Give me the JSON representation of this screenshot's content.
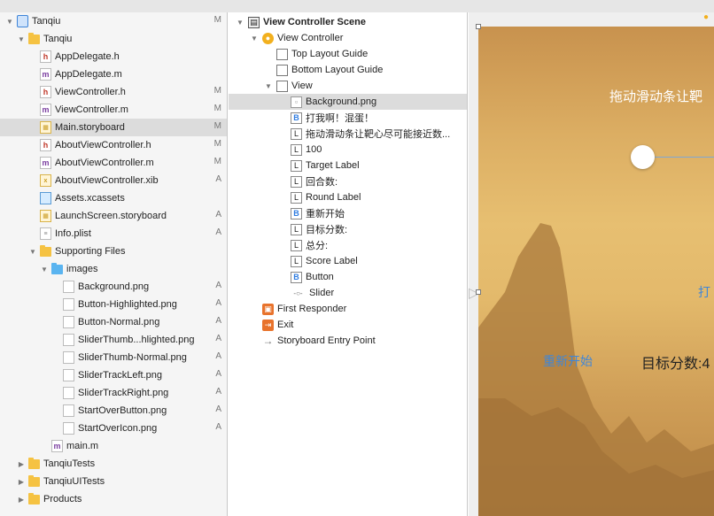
{
  "navigator": {
    "items": [
      {
        "label": "Tanqiu",
        "badge": "M",
        "icon": "xcode-project-icon",
        "kind": "proj",
        "indent": 0,
        "disclosure": "open"
      },
      {
        "label": "Tanqiu",
        "badge": "",
        "icon": "folder-icon",
        "kind": "folder",
        "indent": 1,
        "disclosure": "open"
      },
      {
        "label": "AppDelegate.h",
        "badge": "",
        "icon": "header-file-icon",
        "kind": "h",
        "indent": 2,
        "disclosure": ""
      },
      {
        "label": "AppDelegate.m",
        "badge": "",
        "icon": "implementation-file-icon",
        "kind": "m",
        "indent": 2,
        "disclosure": ""
      },
      {
        "label": "ViewController.h",
        "badge": "M",
        "icon": "header-file-icon",
        "kind": "h",
        "indent": 2,
        "disclosure": ""
      },
      {
        "label": "ViewController.m",
        "badge": "M",
        "icon": "implementation-file-icon",
        "kind": "m",
        "indent": 2,
        "disclosure": ""
      },
      {
        "label": "Main.storyboard",
        "badge": "M",
        "icon": "storyboard-file-icon",
        "kind": "sb",
        "indent": 2,
        "disclosure": "",
        "selected": true
      },
      {
        "label": "AboutViewController.h",
        "badge": "M",
        "icon": "header-file-icon",
        "kind": "h",
        "indent": 2,
        "disclosure": ""
      },
      {
        "label": "AboutViewController.m",
        "badge": "M",
        "icon": "implementation-file-icon",
        "kind": "m",
        "indent": 2,
        "disclosure": ""
      },
      {
        "label": "AboutViewController.xib",
        "badge": "A",
        "icon": "xib-file-icon",
        "kind": "xib",
        "indent": 2,
        "disclosure": ""
      },
      {
        "label": "Assets.xcassets",
        "badge": "",
        "icon": "asset-catalog-icon",
        "kind": "assets",
        "indent": 2,
        "disclosure": ""
      },
      {
        "label": "LaunchScreen.storyboard",
        "badge": "A",
        "icon": "storyboard-file-icon",
        "kind": "sb",
        "indent": 2,
        "disclosure": ""
      },
      {
        "label": "Info.plist",
        "badge": "A",
        "icon": "plist-file-icon",
        "kind": "plist",
        "indent": 2,
        "disclosure": ""
      },
      {
        "label": "Supporting Files",
        "badge": "",
        "icon": "folder-icon",
        "kind": "folder",
        "indent": 2,
        "disclosure": "open"
      },
      {
        "label": "images",
        "badge": "",
        "icon": "blue-folder-icon",
        "kind": "bluefolder",
        "indent": 3,
        "disclosure": "open"
      },
      {
        "label": "Background.png",
        "badge": "A",
        "icon": "image-file-icon",
        "kind": "img",
        "indent": 4,
        "disclosure": ""
      },
      {
        "label": "Button-Highlighted.png",
        "badge": "A",
        "icon": "image-file-icon",
        "kind": "img",
        "indent": 4,
        "disclosure": ""
      },
      {
        "label": "Button-Normal.png",
        "badge": "A",
        "icon": "image-file-icon",
        "kind": "img",
        "indent": 4,
        "disclosure": ""
      },
      {
        "label": "SliderThumb...hlighted.png",
        "badge": "A",
        "icon": "image-file-icon",
        "kind": "img",
        "indent": 4,
        "disclosure": ""
      },
      {
        "label": "SliderThumb-Normal.png",
        "badge": "A",
        "icon": "image-file-icon",
        "kind": "img",
        "indent": 4,
        "disclosure": ""
      },
      {
        "label": "SliderTrackLeft.png",
        "badge": "A",
        "icon": "image-file-icon",
        "kind": "img",
        "indent": 4,
        "disclosure": ""
      },
      {
        "label": "SliderTrackRight.png",
        "badge": "A",
        "icon": "image-file-icon",
        "kind": "img",
        "indent": 4,
        "disclosure": ""
      },
      {
        "label": "StartOverButton.png",
        "badge": "A",
        "icon": "image-file-icon",
        "kind": "img",
        "indent": 4,
        "disclosure": ""
      },
      {
        "label": "StartOverIcon.png",
        "badge": "A",
        "icon": "image-file-icon",
        "kind": "img",
        "indent": 4,
        "disclosure": ""
      },
      {
        "label": "main.m",
        "badge": "",
        "icon": "implementation-file-icon",
        "kind": "m",
        "indent": 3,
        "disclosure": ""
      },
      {
        "label": "TanqiuTests",
        "badge": "",
        "icon": "folder-icon",
        "kind": "folder",
        "indent": 1,
        "disclosure": "closed"
      },
      {
        "label": "TanqiuUITests",
        "badge": "",
        "icon": "folder-icon",
        "kind": "folder",
        "indent": 1,
        "disclosure": "closed"
      },
      {
        "label": "Products",
        "badge": "",
        "icon": "folder-icon",
        "kind": "folder",
        "indent": 1,
        "disclosure": "closed"
      }
    ]
  },
  "outline": {
    "items": [
      {
        "label": "View Controller Scene",
        "icon": "scene-icon",
        "kind": "scene",
        "glyph": "▤",
        "indent": 0,
        "disclosure": "open",
        "bold": true
      },
      {
        "label": "View Controller",
        "icon": "view-controller-icon",
        "kind": "vc",
        "glyph": "●",
        "indent": 1,
        "disclosure": "open"
      },
      {
        "label": "Top Layout Guide",
        "icon": "layout-guide-icon",
        "kind": "guide",
        "glyph": "",
        "indent": 2,
        "disclosure": ""
      },
      {
        "label": "Bottom Layout Guide",
        "icon": "layout-guide-icon",
        "kind": "guide",
        "glyph": "",
        "indent": 2,
        "disclosure": ""
      },
      {
        "label": "View",
        "icon": "view-icon",
        "kind": "guide",
        "glyph": "",
        "indent": 2,
        "disclosure": "open"
      },
      {
        "label": "Background.png",
        "icon": "image-view-icon",
        "kind": "img",
        "glyph": "▫",
        "indent": 3,
        "disclosure": "",
        "selected": true
      },
      {
        "label": "打我啊！混蛋！",
        "icon": "button-icon",
        "kind": "btn",
        "glyph": "B",
        "indent": 3,
        "disclosure": ""
      },
      {
        "label": "拖动滑动条让靶心尽可能接近数...",
        "icon": "label-icon",
        "kind": "lbl",
        "glyph": "L",
        "indent": 3,
        "disclosure": ""
      },
      {
        "label": "100",
        "icon": "label-icon",
        "kind": "lbl",
        "glyph": "L",
        "indent": 3,
        "disclosure": ""
      },
      {
        "label": "Target Label",
        "icon": "label-icon",
        "kind": "lbl",
        "glyph": "L",
        "indent": 3,
        "disclosure": ""
      },
      {
        "label": "回合数:",
        "icon": "label-icon",
        "kind": "lbl",
        "glyph": "L",
        "indent": 3,
        "disclosure": ""
      },
      {
        "label": "Round Label",
        "icon": "label-icon",
        "kind": "lbl",
        "glyph": "L",
        "indent": 3,
        "disclosure": ""
      },
      {
        "label": "重新开始",
        "icon": "button-icon",
        "kind": "btn",
        "glyph": "B",
        "indent": 3,
        "disclosure": ""
      },
      {
        "label": "目标分数:",
        "icon": "label-icon",
        "kind": "lbl",
        "glyph": "L",
        "indent": 3,
        "disclosure": ""
      },
      {
        "label": "总分:",
        "icon": "label-icon",
        "kind": "lbl",
        "glyph": "L",
        "indent": 3,
        "disclosure": ""
      },
      {
        "label": "Score Label",
        "icon": "label-icon",
        "kind": "lbl",
        "glyph": "L",
        "indent": 3,
        "disclosure": ""
      },
      {
        "label": "Button",
        "icon": "button-icon",
        "kind": "btn",
        "glyph": "B",
        "indent": 3,
        "disclosure": ""
      },
      {
        "label": "Slider",
        "icon": "slider-icon",
        "kind": "slider",
        "glyph": "-○-",
        "indent": 3,
        "disclosure": ""
      },
      {
        "label": "First Responder",
        "icon": "first-responder-icon",
        "kind": "responder",
        "glyph": "▣",
        "indent": 1,
        "disclosure": ""
      },
      {
        "label": "Exit",
        "icon": "exit-icon",
        "kind": "exit",
        "glyph": "⇥",
        "indent": 1,
        "disclosure": ""
      },
      {
        "label": "Storyboard Entry Point",
        "icon": "entry-point-arrow-icon",
        "kind": "arrow",
        "glyph": "→",
        "indent": 1,
        "disclosure": ""
      }
    ]
  },
  "canvas": {
    "title_label": "拖动滑动条让靶",
    "hit_button": "打",
    "restart_button": "重新开始",
    "target_score_label": "目标分数:4",
    "accent_color": "#3f86d8"
  }
}
